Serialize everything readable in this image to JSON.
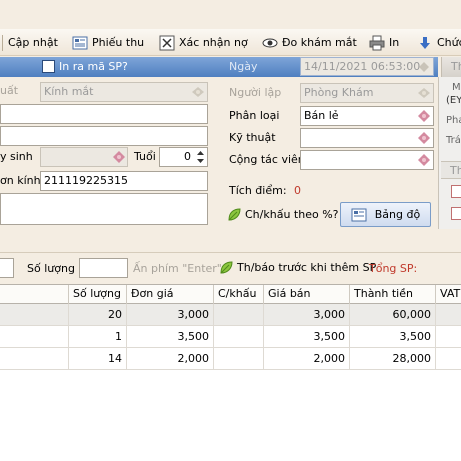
{
  "toolbar": {
    "update_label": "Cập nhật",
    "receipt_label": "Phiếu thu",
    "confirm_debt_label": "Xác nhận nợ",
    "eye_exam_label": "Đo khám mắt",
    "print_label": "In",
    "features_label": "Chức"
  },
  "header": {
    "print_code_label": "In ra mã SP?",
    "date_label": "Ngày",
    "date_value": "14/11/2021 06:53:00",
    "right_tab": "Th"
  },
  "left_form": {
    "origin_label": "uất",
    "product_value": "Kính mắt",
    "dob_label": "y sinh",
    "age_label": "Tuổi",
    "age_value": "0",
    "prescription_label": "ơn kính",
    "prescription_value": "211119225315"
  },
  "mid_form": {
    "creator_label": "Người lập",
    "creator_value": "Phòng Khám",
    "category_label": "Phân loại",
    "category_value": "Bán lẻ",
    "technician_label": "Kỹ thuật",
    "technician_value": "",
    "collaborator_label": "Cộng tác viên",
    "collaborator_value": "",
    "points_label": "Tích điểm:",
    "points_value": "0",
    "discount_label": "Ch/khấu theo %?",
    "price_table_button": "Bảng độ"
  },
  "right_panel": {
    "line1": "M",
    "line2": "(EY",
    "line3": "Pha",
    "line4": "Trá",
    "tab2": "Th"
  },
  "entry_bar": {
    "qty_label": "Số lượng",
    "qty_value": "",
    "enter_hint": "Ấn phím \"Enter\"",
    "notify_label": "Th/báo trước khi thêm SP",
    "total_label": "Tổng SP:"
  },
  "grid": {
    "columns": [
      "Số lượng",
      "Đơn giá",
      "C/khấu",
      "Giá bán",
      "Thành tiền",
      "VAT"
    ],
    "rows": [
      {
        "qty": "20",
        "unit_price": "3,000",
        "discount": "",
        "sale_price": "3,000",
        "amount": "60,000"
      },
      {
        "qty": "1",
        "unit_price": "3,500",
        "discount": "",
        "sale_price": "3,500",
        "amount": "3,500"
      },
      {
        "qty": "14",
        "unit_price": "2,000",
        "discount": "",
        "sale_price": "2,000",
        "amount": "28,000"
      }
    ]
  },
  "colors": {
    "header_blue": "#5b8ac8",
    "total_red": "#c0392b",
    "points_red": "#c0392b"
  }
}
